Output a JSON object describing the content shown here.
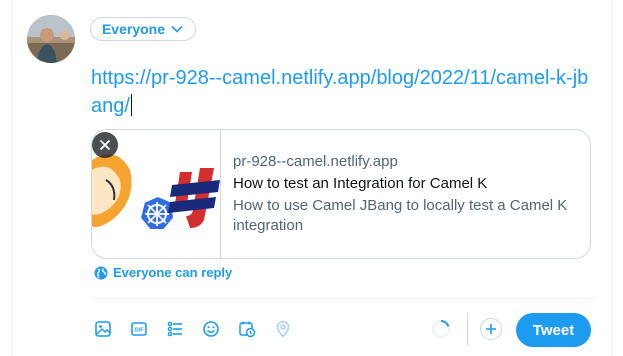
{
  "composer": {
    "audience_label": "Everyone",
    "text": "https://pr-928--camel.netlify.app/blog/2022/11/camel-k-jbang/",
    "reply_setting": "Everyone can reply",
    "tweet_label": "Tweet"
  },
  "link_card": {
    "domain": "pr-928--camel.netlify.app",
    "title": "How to test an Integration for Camel K",
    "description": "How to use Camel JBang to locally test a Camel K integration"
  },
  "toolbar": {
    "icons": [
      "media-icon",
      "gif-icon",
      "poll-icon",
      "emoji-icon",
      "schedule-icon",
      "location-icon"
    ]
  },
  "colors": {
    "accent": "#1d9bf0",
    "border": "#cfd9de",
    "text_primary": "#0f1419",
    "text_secondary": "#536471"
  }
}
